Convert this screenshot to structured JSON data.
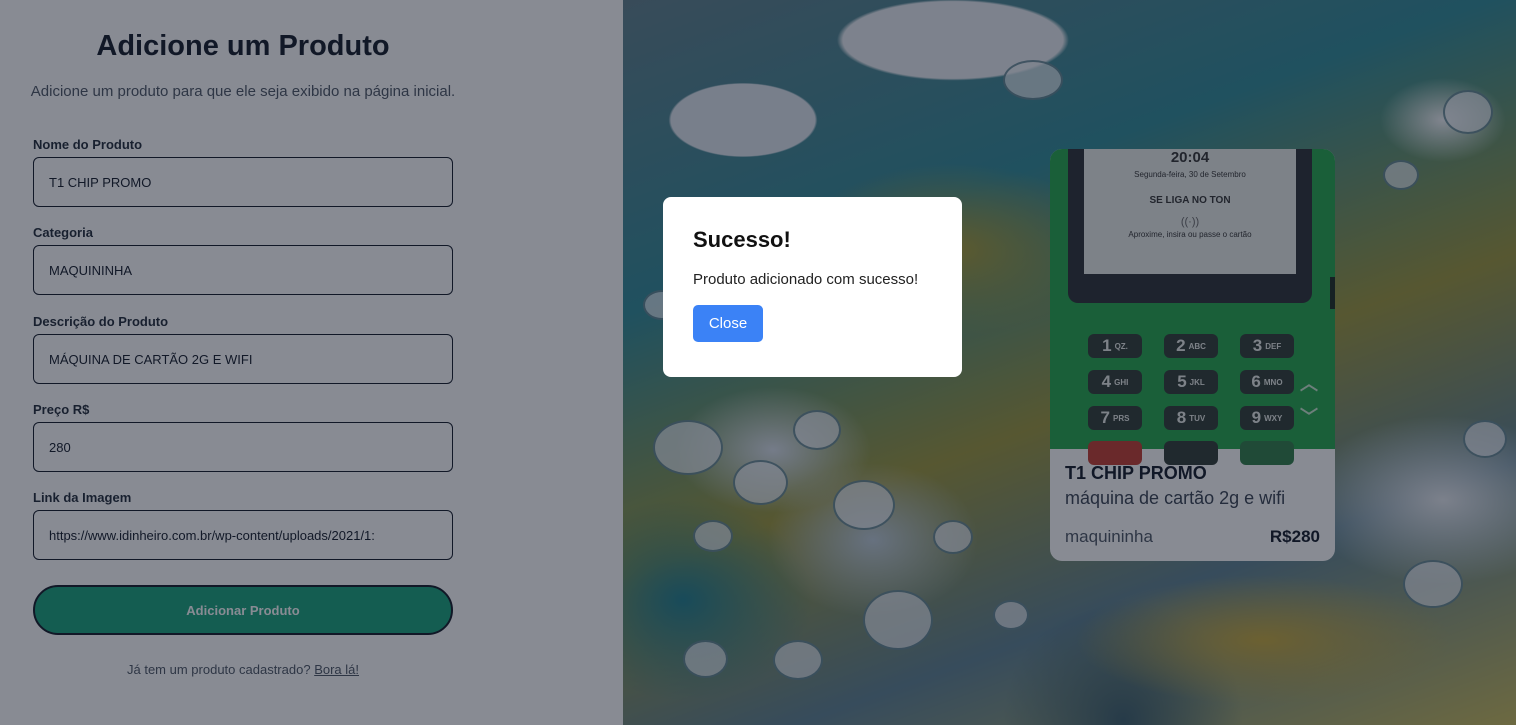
{
  "form": {
    "title": "Adicione um Produto",
    "subtitle": "Adicione um produto para que ele seja exibido na página inicial.",
    "fields": [
      {
        "label": "Nome do Produto",
        "value": "T1 CHIP PROMO"
      },
      {
        "label": "Categoria",
        "value": "MAQUININHA"
      },
      {
        "label": "Descrição do Produto",
        "value": "MÁQUINA DE CARTÃO 2G E WIFI"
      },
      {
        "label": "Preço R$",
        "value": "280"
      },
      {
        "label": "Link da Imagem",
        "value": "https://www.idinheiro.com.br/wp-content/uploads/2021/1:"
      }
    ],
    "submit_label": "Adicionar Produto",
    "login_prompt": "Já tem um produto cadastrado?",
    "login_link": "Bora lá!"
  },
  "card": {
    "device": {
      "time": "20:04",
      "date": "Segunda-feira, 30 de Setembro",
      "slogan": "SE LIGA NO TON",
      "nfc_symbol": "((·))",
      "hint": "Aproxime, insira ou passe o cartão",
      "keys": [
        {
          "n": "1",
          "l": "QZ."
        },
        {
          "n": "2",
          "l": "ABC"
        },
        {
          "n": "3",
          "l": "DEF"
        },
        {
          "n": "4",
          "l": "GHI"
        },
        {
          "n": "5",
          "l": "JKL"
        },
        {
          "n": "6",
          "l": "MNO"
        },
        {
          "n": "7",
          "l": "PRS"
        },
        {
          "n": "8",
          "l": "TUV"
        },
        {
          "n": "9",
          "l": "WXY"
        }
      ]
    },
    "name": "T1 CHIP PROMO",
    "description": "máquina de cartão 2g e wifi",
    "category": "maquininha",
    "price": "R$280"
  },
  "modal": {
    "title": "Sucesso!",
    "message": "Produto adicionado com sucesso!",
    "close_label": "Close"
  },
  "colors": {
    "submit_bg": "#16a37b",
    "close_bg": "#3b82f6",
    "device_green": "#22a64a"
  }
}
